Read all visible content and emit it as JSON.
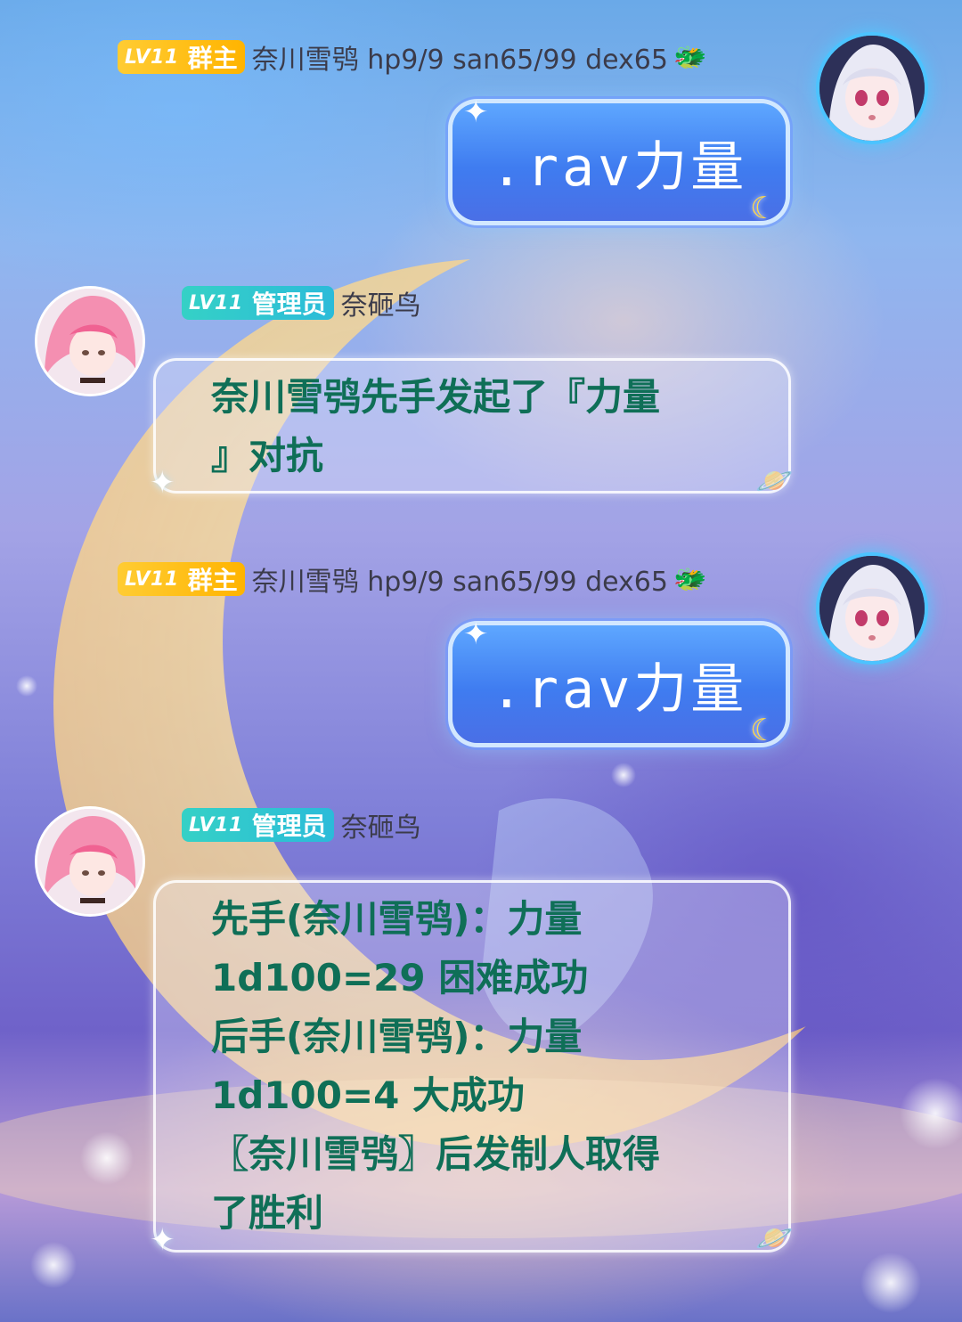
{
  "messages": [
    {
      "sender": {
        "level": "LV11",
        "role": "群主",
        "nick": "奈川雪鸮 hp9/9 san65/99 dex65"
      },
      "side": "right",
      "text": ".rav力量"
    },
    {
      "sender": {
        "level": "LV11",
        "role": "管理员",
        "nick": "奈砸鸟"
      },
      "side": "left",
      "text": "奈川雪鸮先手发起了『力量\n』对抗"
    },
    {
      "sender": {
        "level": "LV11",
        "role": "群主",
        "nick": "奈川雪鸮 hp9/9 san65/99 dex65"
      },
      "side": "right",
      "text": ".rav力量"
    },
    {
      "sender": {
        "level": "LV11",
        "role": "管理员",
        "nick": "奈砸鸟"
      },
      "side": "left",
      "text": "先手(奈川雪鸮)：力量\n1d100=29 困难成功\n后手(奈川雪鸮)：力量\n1d100=4 大成功\n〖奈川雪鸮〗后发制人取得\n了胜利"
    }
  ],
  "icons": {
    "dragon": "dragon-emoji-icon",
    "owner_avatar": "white-haired-girl-avatar",
    "admin_avatar": "pink-haired-girl-avatar"
  },
  "colors": {
    "owner_badge": "#ffbb1a",
    "admin_badge": "#2ec5cf",
    "bubble_blue": "#4a86f2",
    "glass_text": "#0f6f57"
  }
}
